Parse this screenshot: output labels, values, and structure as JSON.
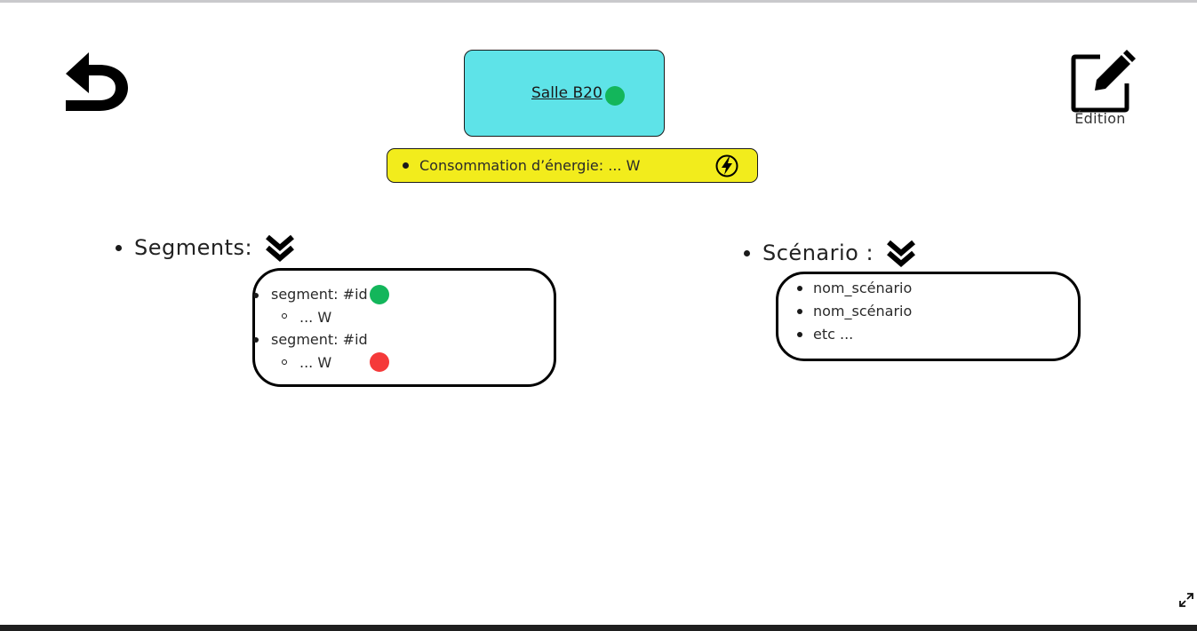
{
  "room": {
    "name": "Salle B20",
    "status_color": "#13b65b",
    "card_color": "#5ee3e8"
  },
  "energy": {
    "label": "Consommation d’énergie: ... W",
    "icon": "lightning-icon",
    "bar_color": "#f2ec1c"
  },
  "header": {
    "back_icon": "undo-arrow-icon",
    "edit_icon": "edit-icon",
    "edit_label": "Édition"
  },
  "segments": {
    "title": "Segments:",
    "items": [
      {
        "label": "segment: #id",
        "power": "... W",
        "status_color": "#13b65b"
      },
      {
        "label": "segment: #id",
        "power": "... W",
        "status_color": "#f53a3a"
      }
    ]
  },
  "scenarios": {
    "title": "Scénario :",
    "items": [
      "nom_scénario",
      "nom_scénario",
      "etc ..."
    ]
  },
  "footer": {
    "expand_icon": "expand-icon"
  }
}
